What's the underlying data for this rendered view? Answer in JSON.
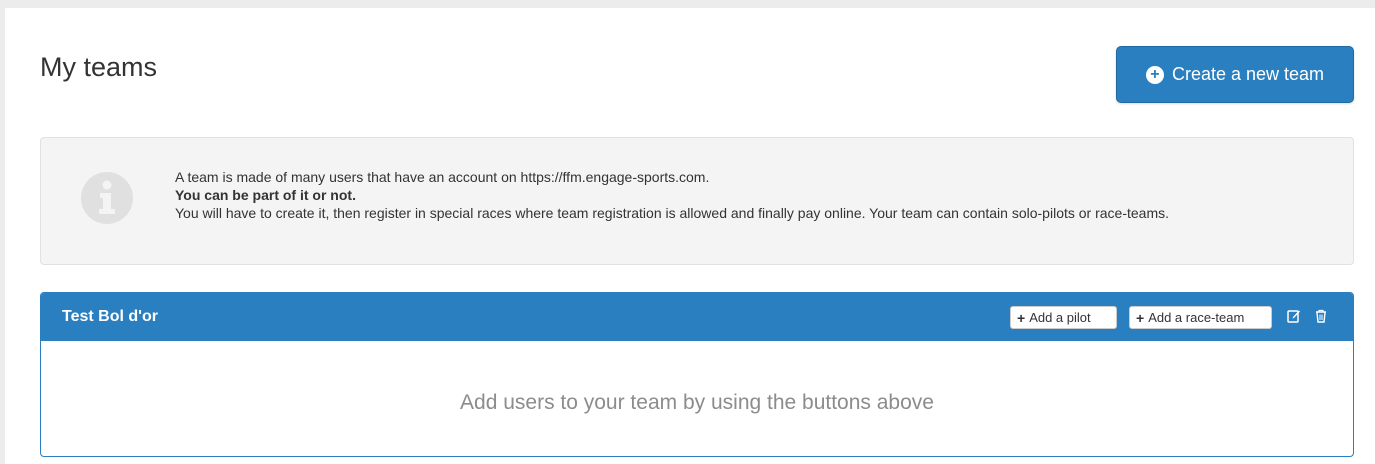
{
  "header": {
    "title": "My teams",
    "create_button_label": "Create a new team"
  },
  "info": {
    "line1": "A team is made of many users that have an account on https://ffm.engage-sports.com.",
    "line2": "You can be part of it or not.",
    "line3": "You will have to create it, then register in special races where team registration is allowed and finally pay online. Your team can contain solo-pilots or race-teams.",
    "icon": "info-circle-icon"
  },
  "team": {
    "name": "Test Bol d'or",
    "add_pilot_label": "Add a pilot",
    "add_raceteam_label": "Add a race-team",
    "empty_message": "Add users to your team by using the buttons above"
  },
  "colors": {
    "primary": "#2a7fc0",
    "info_bg": "#f4f4f4",
    "muted_text": "#8c8c8c"
  }
}
